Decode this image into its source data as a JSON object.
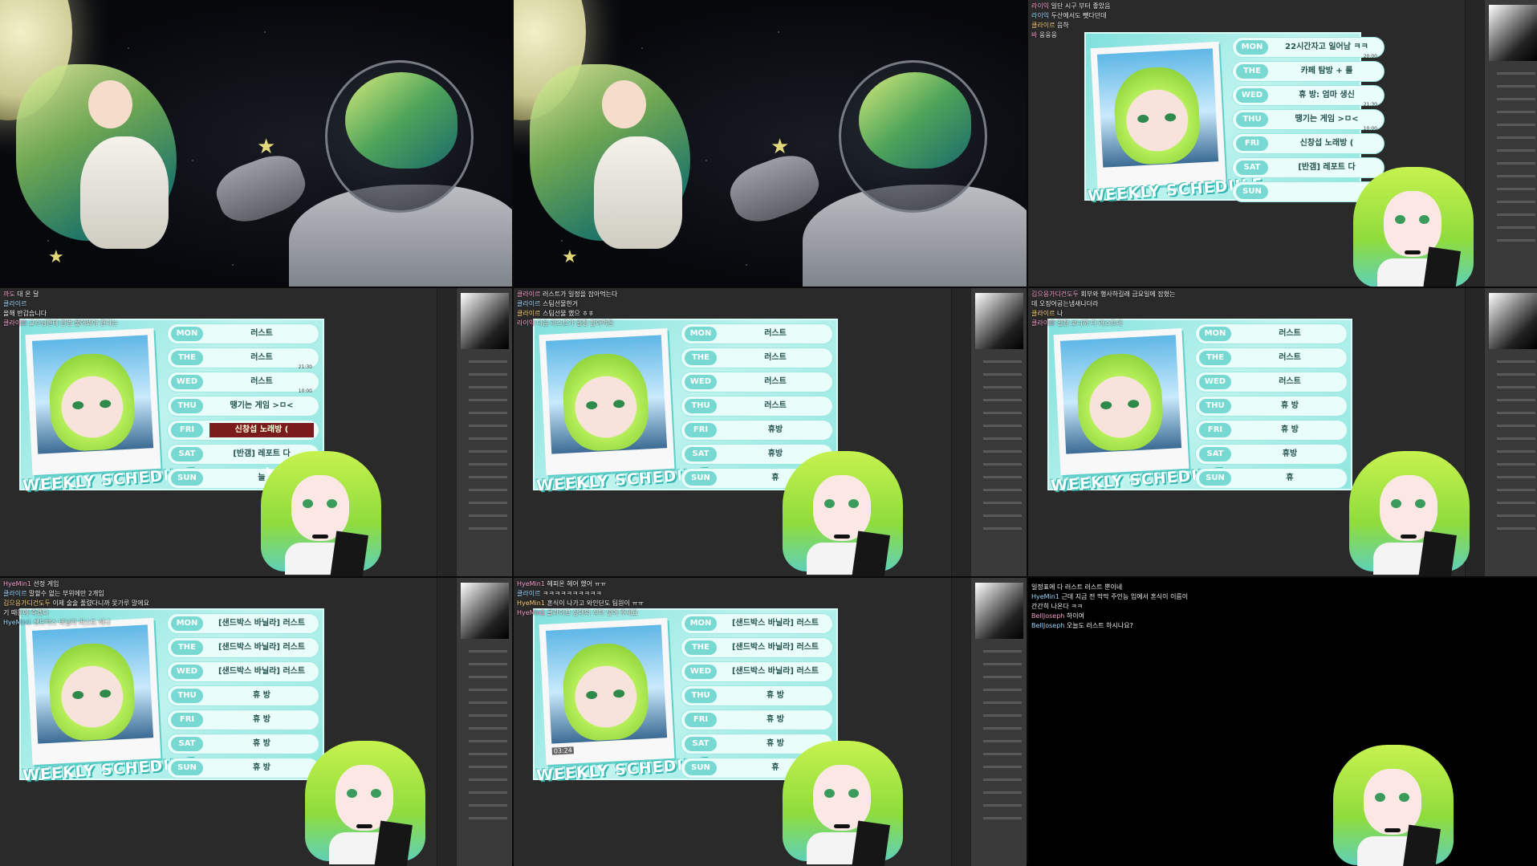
{
  "tiles": {
    "t1": {
      "type": "illustration"
    },
    "t2": {
      "type": "illustration"
    },
    "t3": {
      "chat": [
        {
          "name": "라이익",
          "text": "일단 시구 부터 좋았음"
        },
        {
          "name": "라이익",
          "text": "두산에서도 뺏다던데"
        },
        {
          "name": "클라이르",
          "text": "음하"
        },
        {
          "name": "바",
          "text": "웅웅웅"
        }
      ],
      "rows": [
        {
          "day": "MON",
          "event": "22시간자고 일어남 ㅋㅋ",
          "time": ""
        },
        {
          "day": "THE",
          "event": "카페 탐방 + 롤",
          "time": "20:00"
        },
        {
          "day": "WED",
          "event": "휴 방: 엄마 생신",
          "time": ""
        },
        {
          "day": "THU",
          "event": "땡기는 게임 >ㅁ<",
          "time": "21:30"
        },
        {
          "day": "FRI",
          "event": "신창섭 노래방 (",
          "time": "10:00"
        },
        {
          "day": "SAT",
          "event": "[반갬] 레포트 다",
          "time": ""
        },
        {
          "day": "SUN",
          "event": "",
          "time": ""
        }
      ],
      "brand": "WEEKLY SCHEDULE"
    },
    "t4": {
      "chat": [
        {
          "name": "까도",
          "text": "대 온 달"
        },
        {
          "name": "클라이르",
          "text": ""
        },
        {
          "name": "",
          "text": "올해 반갑습니다"
        },
        {
          "name": "클라이르",
          "text": "교수님한테 한번 물어봐야 한다는"
        }
      ],
      "rows": [
        {
          "day": "MON",
          "event": "러스트",
          "time": ""
        },
        {
          "day": "THE",
          "event": "러스트",
          "time": ""
        },
        {
          "day": "WED",
          "event": "러스트",
          "time": "21:30"
        },
        {
          "day": "THU",
          "event": "땡기는 게임 >ㅁ<",
          "time": "10:00"
        },
        {
          "day": "FRI",
          "event": "신창섭 노래방 (",
          "time": ""
        },
        {
          "day": "SAT",
          "event": "[반갬] 레포트 다",
          "time": ""
        },
        {
          "day": "SUN",
          "event": "늘",
          "time": ""
        }
      ],
      "brand": "WEEKLY SCHEDULE"
    },
    "t5": {
      "chat": [
        {
          "name": "클라이르",
          "text": "러스트가 일정을 잡아먹는다"
        },
        {
          "name": "클라이르",
          "text": "스팀선물한거"
        },
        {
          "name": "클라이르",
          "text": "스팀선물 했으 ㅎㅎ"
        },
        {
          "name": "라이익",
          "text": "다음 러스트가 일정 잡아먹은"
        }
      ],
      "rows": [
        {
          "day": "MON",
          "event": "러스트",
          "time": ""
        },
        {
          "day": "THE",
          "event": "러스트",
          "time": ""
        },
        {
          "day": "WED",
          "event": "러스트",
          "time": ""
        },
        {
          "day": "THU",
          "event": "러스트",
          "time": ""
        },
        {
          "day": "FRI",
          "event": "휴방",
          "time": ""
        },
        {
          "day": "SAT",
          "event": "휴방",
          "time": ""
        },
        {
          "day": "SUN",
          "event": "휴",
          "time": ""
        }
      ],
      "brand": "WEEKLY SCHEDULE"
    },
    "t6": {
      "chat": [
        {
          "name": "김으응가디건도두",
          "text": "회부와 행사하길래 금요일에 잡혔는"
        },
        {
          "name": "",
          "text": "데 오징어굽는냄새나더라"
        },
        {
          "name": "클라이르",
          "text": "나"
        },
        {
          "name": "클라이르",
          "text": "일정 보니까 다 러스트네"
        }
      ],
      "rows": [
        {
          "day": "MON",
          "event": "러스트",
          "time": ""
        },
        {
          "day": "THE",
          "event": "러스트",
          "time": ""
        },
        {
          "day": "WED",
          "event": "러스트",
          "time": ""
        },
        {
          "day": "THU",
          "event": "휴 방",
          "time": ""
        },
        {
          "day": "FRI",
          "event": "휴 방",
          "time": ""
        },
        {
          "day": "SAT",
          "event": "휴방",
          "time": ""
        },
        {
          "day": "SUN",
          "event": "휴",
          "time": ""
        }
      ],
      "brand": "WEEKLY SCHEDULE"
    },
    "t7": {
      "chat": [
        {
          "name": "HyeMin1",
          "text": "선정 게임"
        },
        {
          "name": "클라이르",
          "text": "말할수 없는 부위에만 2개임"
        },
        {
          "name": "김으응가디건도두",
          "text": "이제 술술 풀렸다니까 못가루 말에요"
        },
        {
          "name": "",
          "text": "기 때문에 죽겠다"
        },
        {
          "name": "HyeMin1",
          "text": "샌드박스 바닐라 러스트 하나"
        }
      ],
      "rows": [
        {
          "day": "MON",
          "event": "[샌드박스 바닐라] 러스트",
          "time": ""
        },
        {
          "day": "THE",
          "event": "[샌드박스 바닐라] 러스트",
          "time": ""
        },
        {
          "day": "WED",
          "event": "[샌드박스 바닐라] 러스트",
          "time": ""
        },
        {
          "day": "THU",
          "event": "휴 방",
          "time": ""
        },
        {
          "day": "FRI",
          "event": "휴 방",
          "time": ""
        },
        {
          "day": "SAT",
          "event": "휴 방",
          "time": ""
        },
        {
          "day": "SUN",
          "event": "휴 방",
          "time": ""
        }
      ],
      "brand": "WEEKLY SCHEDULE"
    },
    "t8": {
      "chat": [
        {
          "name": "HyeMin1",
          "text": "헤피온 헤어 했어 ㅠㅠ"
        },
        {
          "name": "클라이르",
          "text": "ㅋㅋㅋㅋㅋㅋㅋㅋㅋㅋ"
        },
        {
          "name": "HyeMin1",
          "text": "혼식이 나가고 와인단도 팀원이 ㅠㅠ"
        },
        {
          "name": "HyeMin1",
          "text": "클라이르 상대의 식탁 넣어 주세요"
        }
      ],
      "rows": [
        {
          "day": "MON",
          "event": "[샌드박스 바닐라] 러스트",
          "time": ""
        },
        {
          "day": "THE",
          "event": "[샌드박스 바닐라] 러스트",
          "time": ""
        },
        {
          "day": "WED",
          "event": "[샌드박스 바닐라] 러스트",
          "time": ""
        },
        {
          "day": "THU",
          "event": "휴 방",
          "time": ""
        },
        {
          "day": "FRI",
          "event": "휴 방",
          "time": ""
        },
        {
          "day": "SAT",
          "event": "휴 방",
          "time": ""
        },
        {
          "day": "SUN",
          "event": "휴",
          "time": ""
        }
      ],
      "brand": "WEEKLY SCHEDULE",
      "timestamp": "03:24"
    },
    "t9": {
      "chat": [
        {
          "name": "",
          "text": "일정표에 다 러스트 러스트 뿐이네"
        },
        {
          "name": "HyeMin1",
          "text": "근데 지금 전 막막 주인능 입에서 혼식이 이름이"
        },
        {
          "name": "",
          "text": "간간히 나온다 ㅋㅋ"
        },
        {
          "name": "BellJoseph",
          "text": "하이여"
        },
        {
          "name": "BellJoseph",
          "text": "오늘도 러스트 하시나요?"
        }
      ]
    }
  }
}
